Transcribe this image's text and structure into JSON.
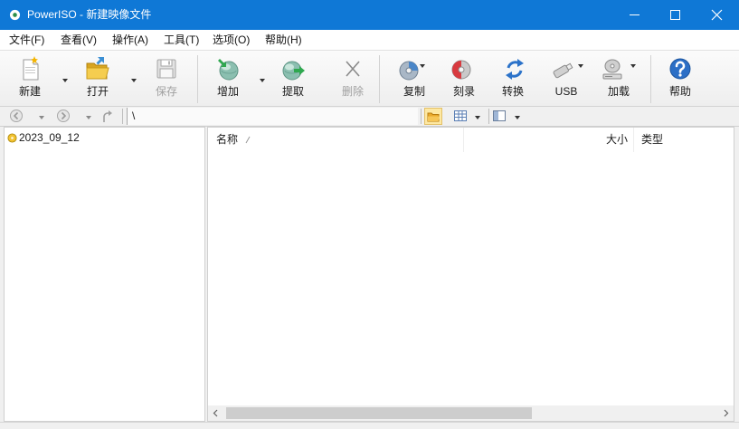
{
  "window": {
    "title": "PowerISO - 新建映像文件",
    "app_icon": "poweriso-disc-icon",
    "controls": [
      "minimize-icon",
      "maximize-icon",
      "close-icon"
    ],
    "colors": {
      "title_bar": "#0f78d6",
      "title_text": "#ffffff"
    }
  },
  "menu": {
    "items": [
      {
        "label": "文件(F)"
      },
      {
        "label": "查看(V)"
      },
      {
        "label": "操作(A)"
      },
      {
        "label": "工具(T)"
      },
      {
        "label": "选项(O)"
      },
      {
        "label": "帮助(H)"
      }
    ]
  },
  "toolbar": {
    "buttons": [
      {
        "label": "新建",
        "icon": "new-file-icon",
        "has_dropdown": true,
        "enabled": true
      },
      {
        "label": "打开",
        "icon": "open-folder-icon",
        "has_dropdown": true,
        "enabled": true
      },
      {
        "label": "保存",
        "icon": "save-disk-icon",
        "has_dropdown": false,
        "enabled": false
      },
      {
        "label": "增加",
        "icon": "add-files-icon",
        "has_dropdown": true,
        "enabled": true
      },
      {
        "label": "提取",
        "icon": "extract-files-icon",
        "has_dropdown": false,
        "enabled": true
      },
      {
        "label": "删除",
        "icon": "delete-x-icon",
        "has_dropdown": false,
        "enabled": false
      },
      {
        "label": "复制",
        "icon": "copy-disc-icon",
        "has_dropdown": true,
        "enabled": true
      },
      {
        "label": "刻录",
        "icon": "burn-disc-icon",
        "has_dropdown": false,
        "enabled": true
      },
      {
        "label": "转换",
        "icon": "convert-arrows-icon",
        "has_dropdown": false,
        "enabled": true
      },
      {
        "label": "USB",
        "icon": "usb-drive-icon",
        "has_dropdown": true,
        "enabled": true
      },
      {
        "label": "加载",
        "icon": "mount-drive-icon",
        "has_dropdown": true,
        "enabled": true
      },
      {
        "label": "帮助",
        "icon": "help-icon",
        "has_dropdown": false,
        "enabled": true
      }
    ],
    "colors": {
      "disabled_text": "#a0a0a0"
    }
  },
  "navigation": {
    "back": {
      "icon": "back-arrow-icon",
      "enabled": false
    },
    "forward": {
      "icon": "forward-arrow-icon",
      "enabled": false
    },
    "up": {
      "icon": "up-folder-icon",
      "enabled": false
    },
    "path": "\\",
    "view_buttons": [
      {
        "icon": "folder-pane-icon",
        "active": true
      },
      {
        "icon": "grid-view-icon",
        "has_dropdown": true
      },
      {
        "icon": "layout-icon",
        "has_dropdown": true
      }
    ],
    "colors": {
      "active_view_bg": "#fde8a3"
    }
  },
  "tree": {
    "items": [
      {
        "label": "2023_09_12",
        "icon": "disc-image-icon"
      }
    ]
  },
  "file_list": {
    "columns": [
      {
        "label": "名称",
        "sorted": true,
        "sort_icon": "sort-indicator-icon"
      },
      {
        "label": "大小"
      },
      {
        "label": "类型"
      }
    ],
    "rows": []
  }
}
